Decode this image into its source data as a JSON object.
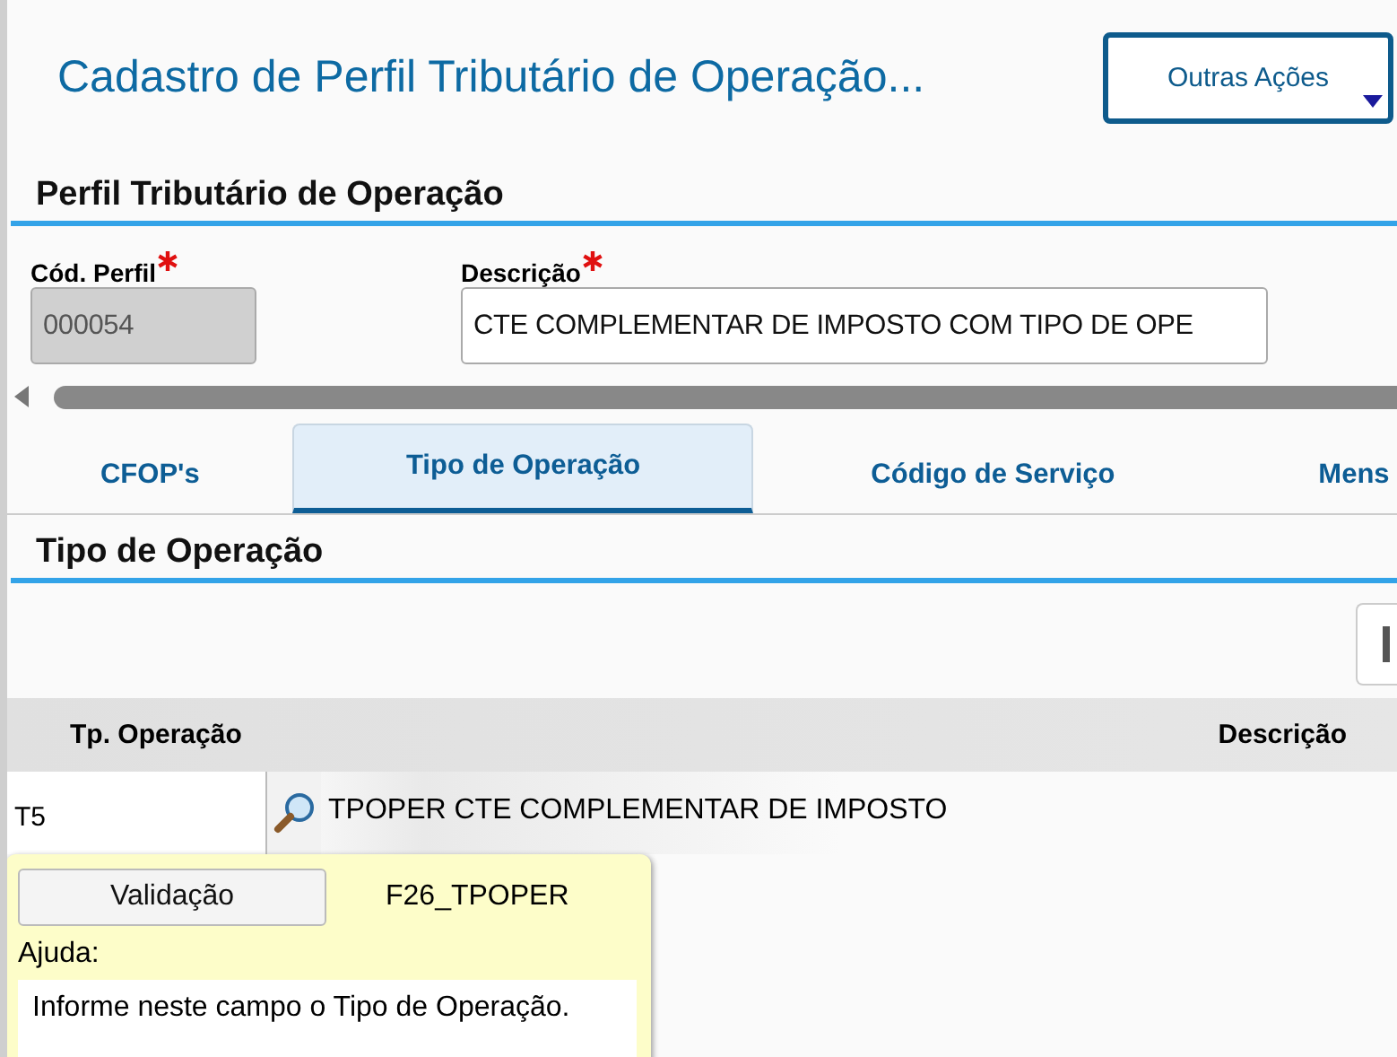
{
  "header": {
    "title": "Cadastro de Perfil Tributário de Operação...",
    "actions_button": "Outras Ações"
  },
  "profile_section": {
    "title": "Perfil Tributário de Operação",
    "fields": [
      {
        "label": "Cód. Perfil",
        "required": true,
        "disabled": true,
        "value": "000054"
      },
      {
        "label": "Descrição",
        "required": true,
        "disabled": false,
        "value": "CTE COMPLEMENTAR DE IMPOSTO COM TIPO DE OPE"
      }
    ]
  },
  "tabs": [
    {
      "label": "CFOP's",
      "selected": false
    },
    {
      "label": "Tipo de Operação",
      "selected": true
    },
    {
      "label": "Código de Serviço",
      "selected": false
    },
    {
      "label": "Mens",
      "selected": false
    }
  ],
  "operation_section": {
    "title": "Tipo de Operação",
    "table": {
      "columns": [
        "Tp. Operação",
        "Descrição"
      ],
      "rows": [
        {
          "code": "T5",
          "description": "TPOPER CTE COMPLEMENTAR DE IMPOSTO"
        }
      ]
    }
  },
  "tooltip": {
    "button": "Validação",
    "field_name": "F26_TPOPER",
    "help_label": "Ajuda:",
    "help_text": "Informe neste campo o Tipo de Operação."
  }
}
